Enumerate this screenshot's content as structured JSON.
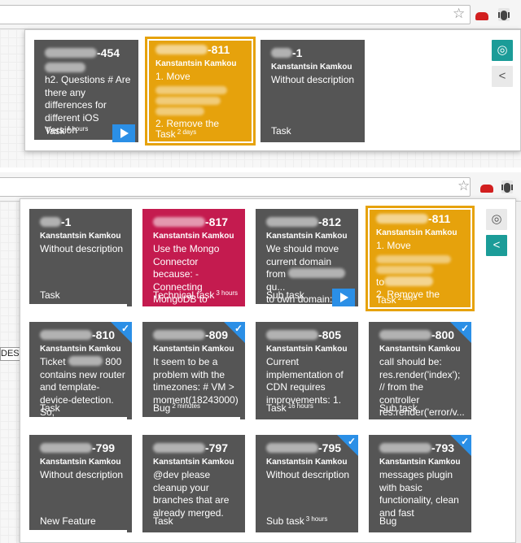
{
  "colors": {
    "tile_grey": "#555555",
    "tile_magenta": "#c41b4f",
    "tile_yellow": "#e6a20c",
    "accent_blue": "#2b8fe6",
    "teal": "#1b9c98"
  },
  "browser": {
    "icons": [
      "star-icon",
      "car-icon",
      "bug-extension-icon"
    ]
  },
  "popup_top": {
    "side_buttons": [
      {
        "icon": "target-icon",
        "glyph": "◎"
      },
      {
        "icon": "share-icon",
        "glyph": "<"
      }
    ],
    "tiles": [
      {
        "key": "-454",
        "author": "",
        "description": [
          "h2. Questions  # Are there any differences for different iOS Version"
        ],
        "type": "Task",
        "time": "4 hours",
        "style": "grey",
        "play": true
      },
      {
        "key": "-811",
        "author": "Kanstantsin Kamkou",
        "description": [
          "1. Move",
          "2. Remove the"
        ],
        "type": "Task",
        "time": "2 days",
        "style": "yellow",
        "play": false
      },
      {
        "key": "-1",
        "author": "Kanstantsin Kamkou",
        "description": [
          "Without description"
        ],
        "type": "Task",
        "time": "",
        "style": "grey",
        "play": false
      }
    ]
  },
  "popup_bottom": {
    "side_buttons": [
      {
        "icon": "target-icon",
        "glyph": "◎"
      },
      {
        "icon": "share-icon",
        "glyph": "<"
      }
    ],
    "side_input_text": "DESC",
    "tiles": [
      {
        "key": "-1",
        "author": "Kanstantsin Kamkou",
        "description": "Without description",
        "type": "Task",
        "time": "",
        "style": "grey"
      },
      {
        "key": "-817",
        "author": "Kanstantsin Kamkou",
        "description": "Use the Mongo Connector because: - Connecting MongoDB to search",
        "type": "Technical task",
        "time": "3 hours",
        "style": "magenta"
      },
      {
        "key": "-812",
        "author": "Kanstantsin Kamkou",
        "description": "We should move current domain from",
        "description_tail": "qu...",
        "description_end": "to own domain:",
        "type": "Sub task",
        "time": "",
        "style": "grey",
        "play": true
      },
      {
        "key": "-811",
        "author": "Kanstantsin Kamkou",
        "description": "1. Move",
        "description_mid": "to",
        "description_end": "2. Remove the",
        "type": "Task",
        "time": "2 days",
        "style": "yellow"
      },
      {
        "key": "-810",
        "author": "Kanstantsin Kamkou",
        "description": "Ticket",
        "description_mid": "800 contains new router and template-device-detection. So,",
        "type": "Task",
        "time": "",
        "style": "grey",
        "check": true
      },
      {
        "key": "-809",
        "author": "Kanstantsin Kamkou",
        "description": "It seem to be a problem with the timezones: # VM > moment(18243000)",
        "type": "Bug",
        "time": "2 minutes",
        "style": "grey",
        "check": true
      },
      {
        "key": "-805",
        "author": "Kanstantsin Kamkou",
        "description": "Current implementation of CDN requires improvements:  1.",
        "type": "Task",
        "time": "16 hours",
        "style": "grey"
      },
      {
        "key": "-800",
        "author": "Kanstantsin Kamkou",
        "description": "call should be: res.render('index'); // from the controller res.render('error/v...",
        "type": "Sub task",
        "time": "",
        "style": "grey",
        "check": true
      },
      {
        "key": "-799",
        "author": "Kanstantsin Kamkou",
        "description": "Without description",
        "type": "New Feature",
        "time": "",
        "style": "grey"
      },
      {
        "key": "-797",
        "author": "Kanstantsin Kamkou",
        "description": "@dev please cleanup your branches that are already merged.",
        "type": "Task",
        "time": "",
        "style": "grey"
      },
      {
        "key": "-795",
        "author": "Kanstantsin Kamkou",
        "description": "Without description",
        "type": "Sub task",
        "time": "3 hours",
        "style": "grey",
        "check": true
      },
      {
        "key": "-793",
        "author": "Kanstantsin Kamkou",
        "description": "messages plugin with basic functionality, clean and fast",
        "type": "Bug",
        "time": "",
        "style": "grey",
        "check": true
      }
    ]
  },
  "progress": {
    "top": [
      0.85,
      0.0,
      0.0
    ],
    "bottom": [
      0.95,
      0.0,
      0.85,
      0.0,
      0.95,
      0.95,
      0.0,
      0.0,
      0.95,
      0.0,
      0.0,
      0.0
    ]
  }
}
